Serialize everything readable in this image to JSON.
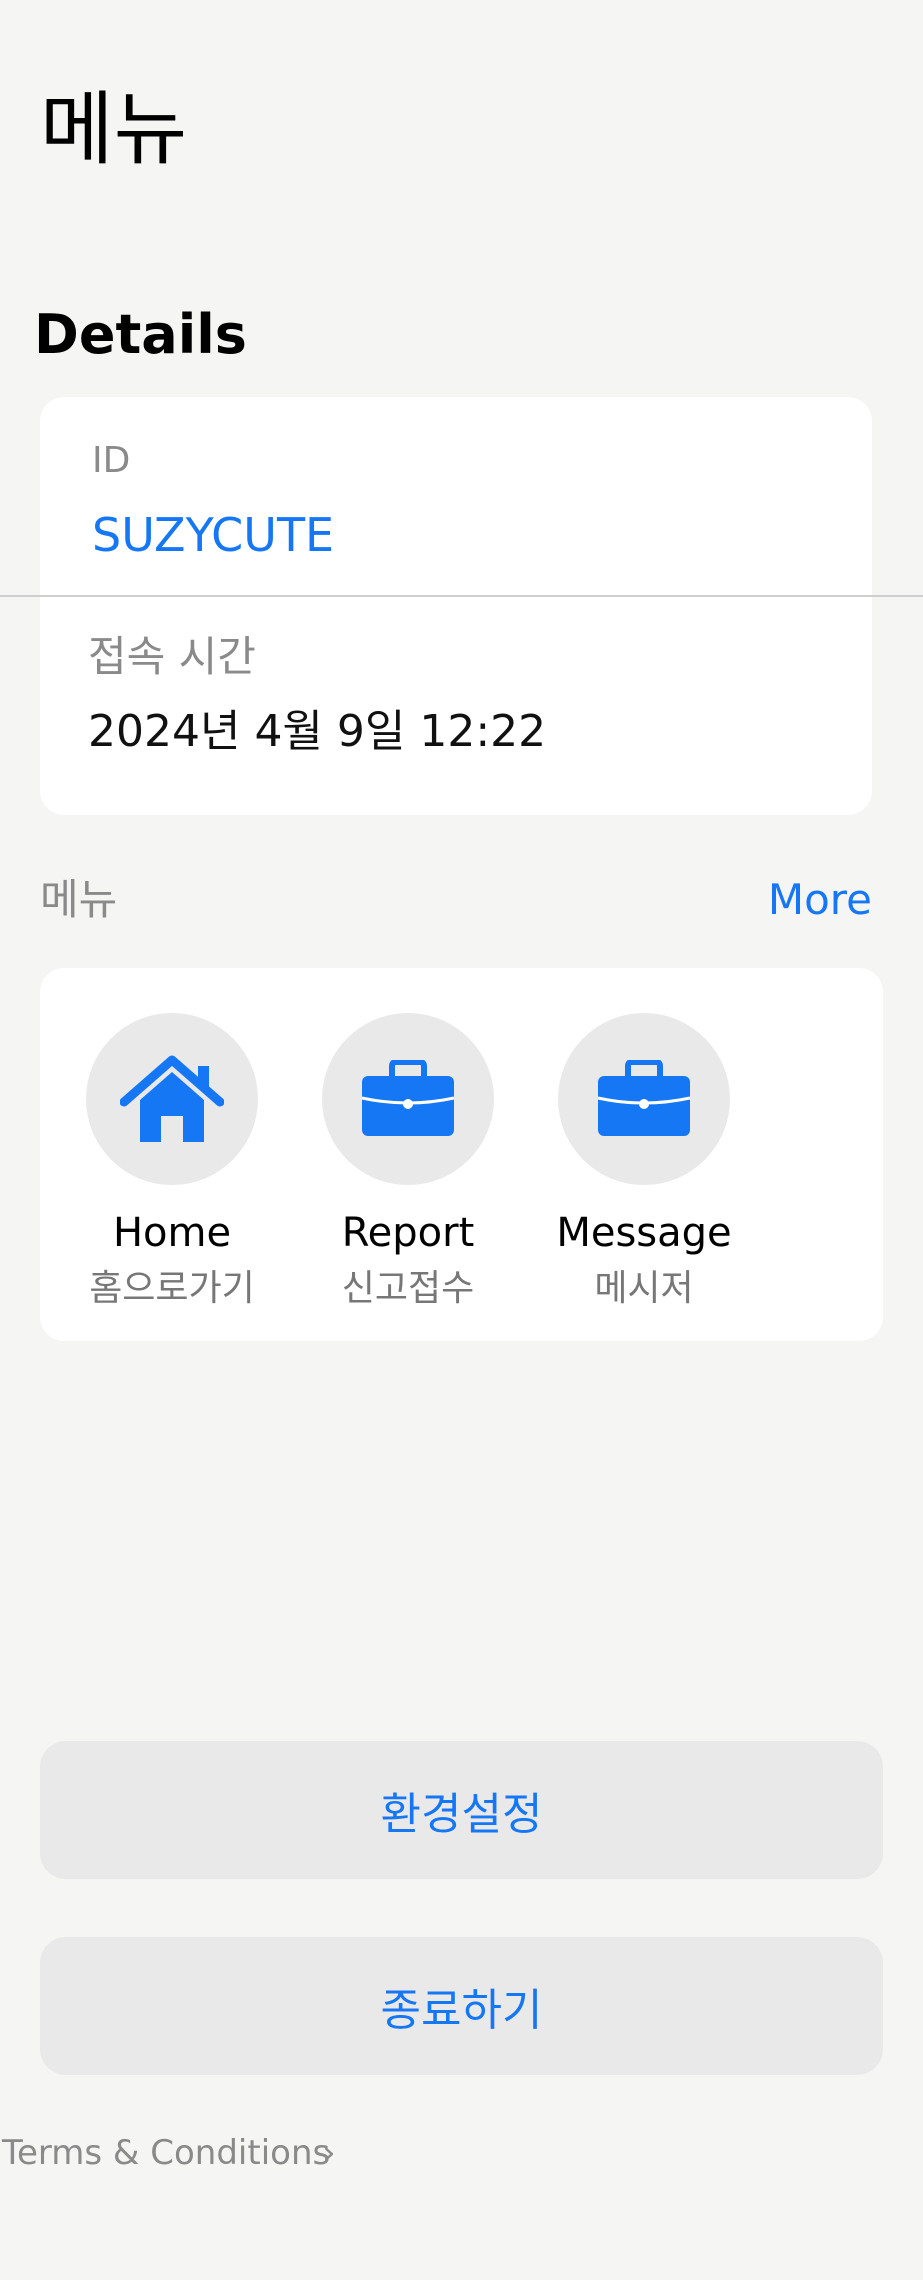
{
  "page_title": "메뉴",
  "details": {
    "section_title": "Details",
    "id_label": "ID",
    "id_value": "SUZYCUTE",
    "time_label": "접속 시간",
    "time_value": "2024년 4월 9일 12:22"
  },
  "menu": {
    "header": "메뉴",
    "more_label": "More",
    "items": [
      {
        "label": "Home",
        "sublabel": "홈으로가기",
        "icon": "house-icon"
      },
      {
        "label": "Report",
        "sublabel": "신고접수",
        "icon": "briefcase-icon"
      },
      {
        "label": "Message",
        "sublabel": "메시저",
        "icon": "briefcase-icon"
      }
    ]
  },
  "buttons": {
    "settings": "환경설정",
    "exit": "종료하기"
  },
  "footer": {
    "terms": "Terms & Conditions",
    "chevron": "›"
  },
  "colors": {
    "accent": "#1677f5",
    "background": "#f5f5f4",
    "card": "#ffffff",
    "button_bg": "#e9e9e9",
    "icon_circle": "#e9e9e9"
  }
}
